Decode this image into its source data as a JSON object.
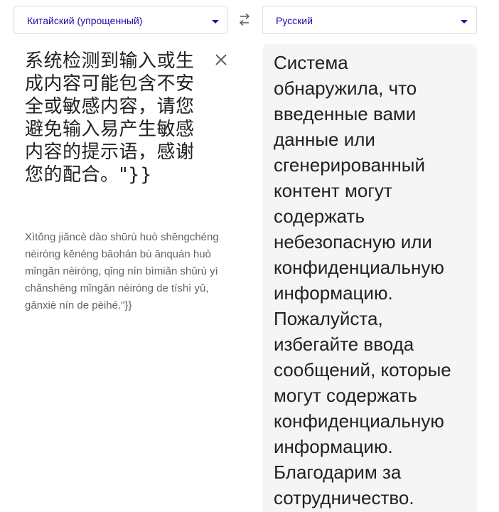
{
  "source_language": {
    "label": "Китайский (упрощенный)"
  },
  "target_language": {
    "label": "Русский"
  },
  "swap": {
    "icon": "swap-arrows-icon"
  },
  "source": {
    "text": "系统检测到输入或生成内容可能包含不安全或敏感内容，请您避免输入易产生敏感内容的提示语，感谢您的配合。\"}}",
    "clear_icon": "close-icon",
    "transliteration": "Xìtǒng jiǎncè dào shūrù huò shēngchéng nèiróng kěnéng bāohán bù ānquán huò mǐngǎn nèiróng, qǐng nín bìmiǎn shūrù yì chǎnshēng mǐngǎn nèiróng de tíshì yǔ, gǎnxiè nín de pèihé.\"}}"
  },
  "target": {
    "lines": [
      "Система",
      "обнаружила, что",
      "введенные вами",
      "данные или",
      "сгенерированный",
      "контент могут",
      "содержать",
      "небезопасную или",
      "конфиденциальную",
      "информацию.",
      "Пожалуйста,",
      "избегайте ввода",
      "сообщений, которые",
      "могут содержать",
      "конфиденциальную",
      "информацию.",
      "Благодарим за",
      "сотрудничество."
    ]
  },
  "colors": {
    "accent": "#1a0dab",
    "text": "#202124",
    "muted": "#5f6368",
    "border": "#dadce0",
    "panel": "#f5f5f5"
  }
}
